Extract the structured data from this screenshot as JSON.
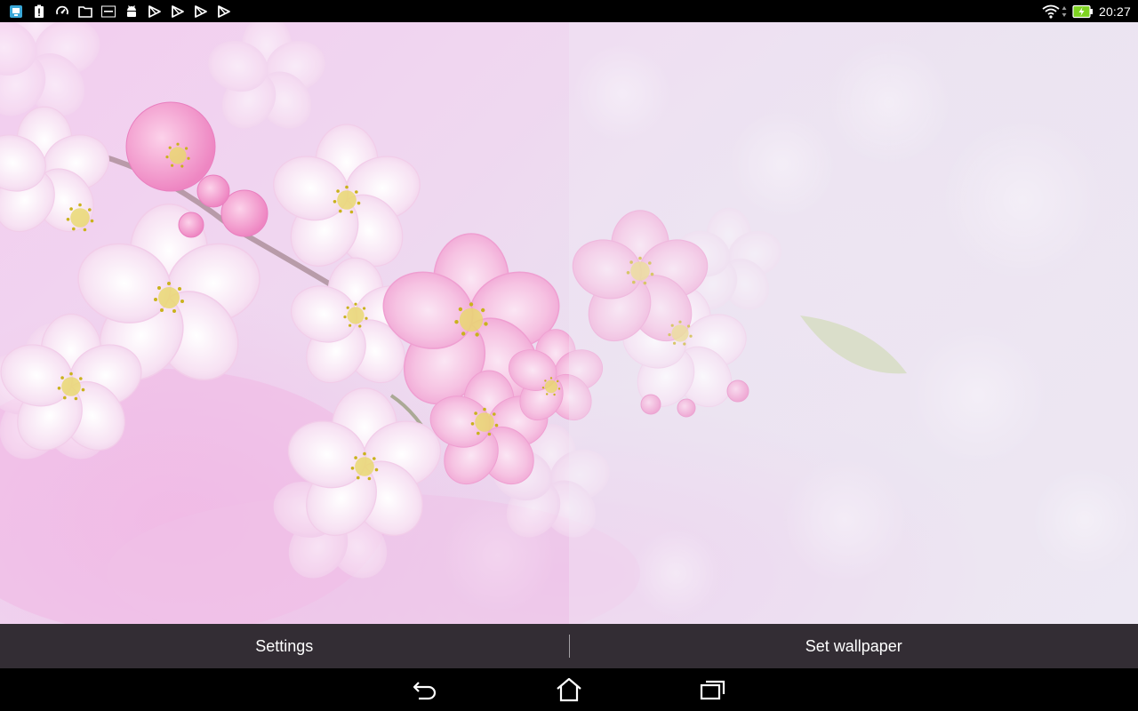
{
  "status_bar": {
    "left_icons": [
      "screenshot-app-icon",
      "battery-alert-icon",
      "speed-gauge-icon",
      "folder-icon",
      "asus-logo-icon",
      "android-debug-icon",
      "play-store-icon",
      "play-store-icon",
      "play-store-icon",
      "play-store-icon"
    ],
    "right_icons": [
      "wifi-icon",
      "data-arrows-icon",
      "battery-charging-icon"
    ],
    "time": "20:27",
    "battery_color": "#7ed321"
  },
  "wallpaper": {
    "subject": "cherry-blossom-live-wallpaper",
    "accent_colors": [
      "#f4a9d6",
      "#f7c4e4",
      "#e6d6ef",
      "#d4c93a"
    ]
  },
  "action_bar": {
    "settings_label": "Settings",
    "set_wallpaper_label": "Set wallpaper"
  },
  "nav_bar": {
    "buttons": [
      "back-icon",
      "home-icon",
      "recent-apps-icon"
    ]
  }
}
